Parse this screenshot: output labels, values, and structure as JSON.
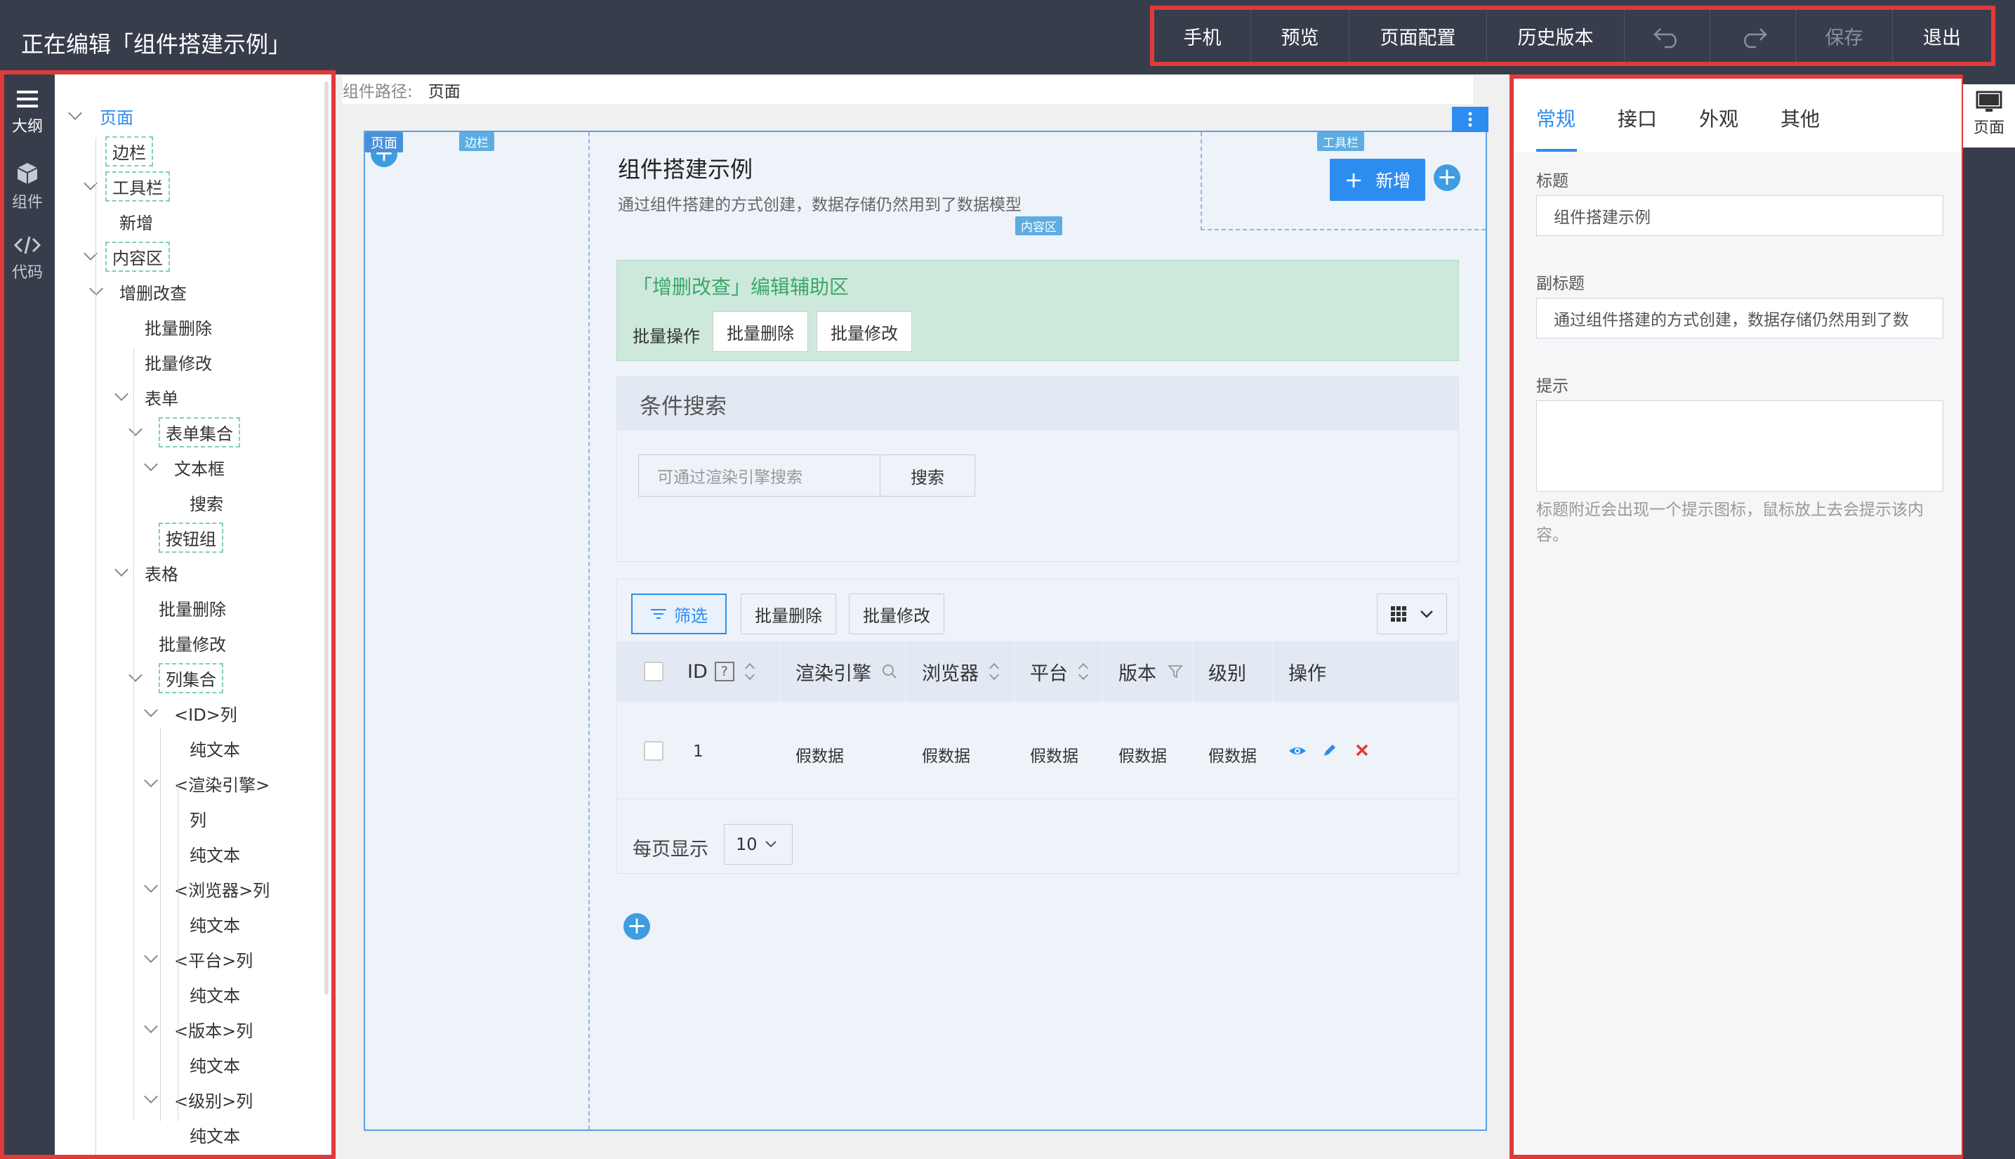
{
  "header": {
    "title": "正在编辑「组件搭建示例」",
    "actions": {
      "mobile": "手机",
      "preview": "预览",
      "page_config": "页面配置",
      "history": "历史版本",
      "save": "保存",
      "exit": "退出"
    }
  },
  "rail": {
    "outline": "大纲",
    "components": "组件",
    "code": "代码"
  },
  "outline": {
    "nodes": [
      "页面",
      "边栏",
      "工具栏",
      "新增",
      "内容区",
      "增删改查",
      "批量删除",
      "批量修改",
      "表单",
      "表单集合",
      "文本框",
      "搜索",
      "按钮组",
      "表格",
      "批量删除",
      "批量修改",
      "列集合",
      "<ID>列",
      "纯文本",
      "<渲染引擎>",
      "列",
      "纯文本",
      "<浏览器>列",
      "纯文本",
      "<平台>列",
      "纯文本",
      "<版本>列",
      "纯文本",
      "<级别>列",
      "纯文本"
    ]
  },
  "breadcrumb": {
    "label": "组件路径:",
    "value": "页面"
  },
  "canvas": {
    "tags": {
      "page": "页面",
      "sidebar": "边栏",
      "toolbar": "工具栏",
      "content": "内容区"
    },
    "title": "组件搭建示例",
    "subtitle": "通过组件搭建的方式创建，数据存储仍然用到了数据模型",
    "add_button": "新增",
    "crud_helper": {
      "title": "「增删改查」编辑辅助区",
      "batch_label": "批量操作",
      "batch_delete": "批量删除",
      "batch_edit": "批量修改"
    },
    "search": {
      "title": "条件搜索",
      "placeholder": "可通过渲染引擎搜索",
      "button": "搜索"
    },
    "table": {
      "filter_button": "筛选",
      "batch_delete": "批量删除",
      "batch_edit": "批量修改",
      "columns": [
        "ID",
        "渲染引擎",
        "浏览器",
        "平台",
        "版本",
        "级别",
        "操作"
      ],
      "row": {
        "id": "1",
        "engine": "假数据",
        "browser": "假数据",
        "platform": "假数据",
        "version": "假数据",
        "grade": "假数据"
      },
      "per_page_label": "每页显示",
      "per_page_value": "10"
    }
  },
  "props": {
    "tabs": [
      "常规",
      "接口",
      "外观",
      "其他"
    ],
    "title_label": "标题",
    "title_value": "组件搭建示例",
    "subtitle_label": "副标题",
    "subtitle_value": "通过组件搭建的方式创建，数据存储仍然用到了数",
    "remark_label": "提示",
    "remark_help": "标题附近会出现一个提示图标，鼠标放上去会提示该内容。"
  },
  "right_rail": {
    "page": "页面"
  },
  "colors": {
    "header_bg": "#373d4b",
    "accent": "#2d8cf0",
    "highlight_border": "#e03a3a",
    "helper_bg": "#cde9dc",
    "helper_title": "#3aa86b"
  }
}
